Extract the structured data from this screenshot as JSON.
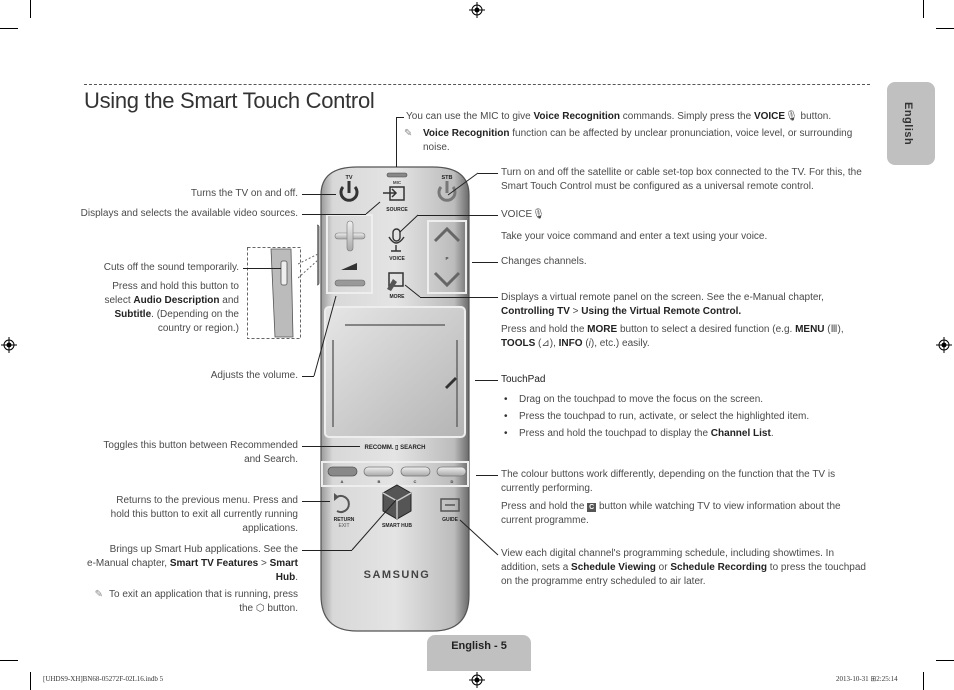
{
  "page": {
    "title": "Using the Smart Touch Control",
    "side_tab": "English",
    "footer_tab": "English - 5",
    "print_left": "[UHDS9-XH]BN68-05272F-02L16.indb   5",
    "print_right": "2013-10-31   ⊞2:25:14"
  },
  "remote": {
    "labels": {
      "tv": "TV",
      "mic": "MIC",
      "stb": "STB",
      "source": "SOURCE",
      "voice": "VOICE",
      "more": "MORE",
      "channel": "P",
      "recomm_search": "RECOMM. ▯ SEARCH",
      "color_a": "A",
      "color_b": "B",
      "color_c": "C",
      "color_d": "D",
      "return": "RETURN",
      "exit": "EXIT",
      "smart_hub": "SMART HUB",
      "guide": "GUIDE",
      "brand": "SAMSUNG"
    }
  },
  "left_callouts": {
    "tv_power": "Turns the TV on and off.",
    "source": "Displays and selects the available video sources.",
    "mute": "Cuts off the sound temporarily.",
    "mute_hold_1": "Press and hold this button to",
    "mute_hold_2a": "select ",
    "mute_hold_2b": "Audio Description",
    "mute_hold_2c": " and",
    "mute_hold_3a": "Subtitle",
    "mute_hold_3b": ". (Depending on the",
    "mute_hold_4": "country or region.)",
    "volume": "Adjusts the volume.",
    "recomm_1": "Toggles this button between Recommended",
    "recomm_2": "and Search.",
    "return_1": "Returns to the previous menu. Press and",
    "return_2": "hold this button to exit all currently running",
    "return_3": "applications.",
    "hub_1": "Brings up Smart Hub applications. See the",
    "hub_2a": "e-Manual chapter, ",
    "hub_2b": "Smart TV Features",
    "hub_2c": " > ",
    "hub_2d": "Smart",
    "hub_3": "Hub",
    "hub_3b": ".",
    "hub_note_1": "To exit an application that is running, press",
    "hub_note_2a": "the ",
    "hub_note_2b": " button."
  },
  "right_callouts": {
    "mic_1a": "You can use the MIC to give ",
    "mic_1b": "Voice Recognition",
    "mic_1c": " commands. Simply press the ",
    "mic_1d": "VOICE",
    "mic_1e": " button.",
    "mic_note_a": "Voice Recognition",
    "mic_note_b": " function can be affected by unclear pronunciation, voice level, or surrounding",
    "mic_note_c": "noise.",
    "stb_1": "Turn on and off the satellite or cable set-top box connected to the TV. For this, the",
    "stb_2": "Smart Touch Control must be configured as a universal remote control.",
    "voice_head": "VOICE",
    "voice_body": "Take your voice command and enter a text using your voice.",
    "channel": "Changes channels.",
    "more_1": "Displays a virtual remote panel on the screen. See the e-Manual chapter,",
    "more_2a": "Controlling TV",
    "more_2b": " > ",
    "more_2c": "Using the Virtual Remote Control.",
    "more_3a": "Press and hold the ",
    "more_3b": "MORE",
    "more_3c": " button to select a desired function (e.g. ",
    "more_3d": "MENU",
    "more_3e": " (",
    "more_3f": "Ⅲ",
    "more_3g": "),",
    "more_4a": "TOOLS",
    "more_4b": " (",
    "more_4c": "⊿",
    "more_4d": "), ",
    "more_4e": "INFO",
    "more_4f": " (",
    "more_4g": "i",
    "more_4h": "), etc.) easily.",
    "touchpad_head": "TouchPad",
    "touchpad_items": [
      "Drag on the touchpad to move the focus on the screen.",
      "Press the touchpad to run, activate, or select the highlighted item."
    ],
    "touchpad_item3a": "Press and hold the touchpad to display the ",
    "touchpad_item3b": "Channel List",
    "touchpad_item3c": ".",
    "color_1": "The colour buttons work differently, depending on the function that the TV is",
    "color_2": "currently performing.",
    "color_3a": "Press and hold the ",
    "color_3b": "C",
    "color_3c": " button while watching TV to view information about the",
    "color_4": "current programme.",
    "guide_1": "View each digital channel's programming schedule, including showtimes. In",
    "guide_2a": "addition, sets a ",
    "guide_2b": "Schedule Viewing",
    "guide_2c": " or ",
    "guide_2d": "Schedule Recording",
    "guide_2e": " to press the touchpad",
    "guide_3": "on the programme entry scheduled to air later."
  }
}
